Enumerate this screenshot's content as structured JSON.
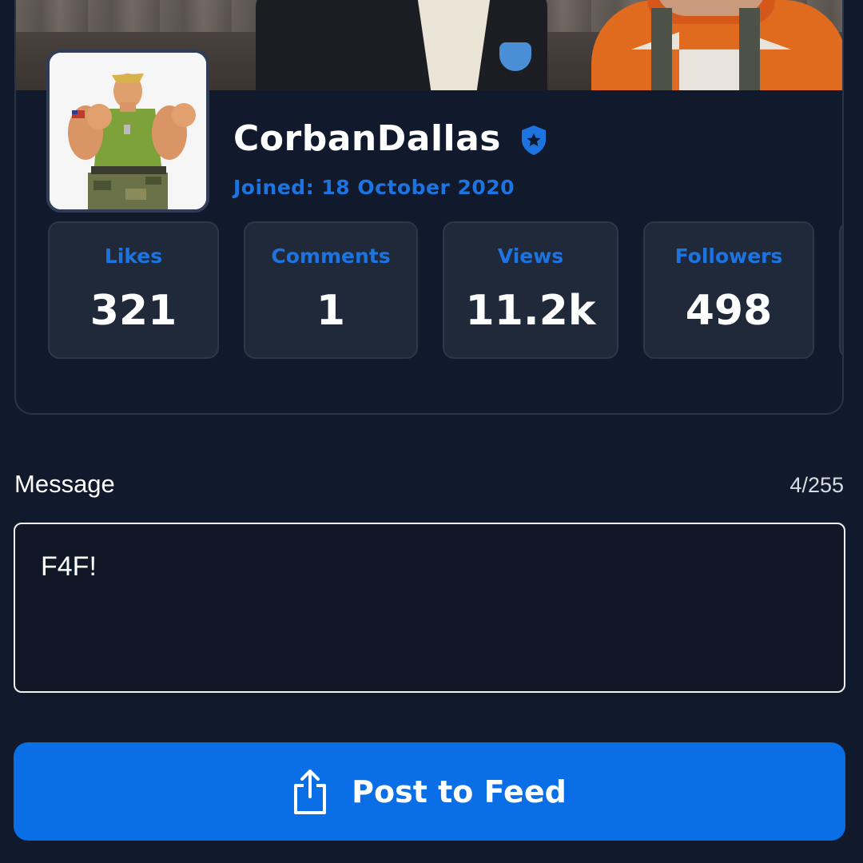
{
  "profile": {
    "username": "CorbanDallas",
    "joined": "Joined: 18 October 2020",
    "verified_icon": "verified-shield-icon"
  },
  "stats": [
    {
      "label": "Likes",
      "value": "321"
    },
    {
      "label": "Comments",
      "value": "1"
    },
    {
      "label": "Views",
      "value": "11.2k"
    },
    {
      "label": "Followers",
      "value": "498"
    }
  ],
  "message": {
    "label": "Message",
    "char_count": "4/255",
    "value": "F4F!"
  },
  "actions": {
    "post_label": "Post to Feed",
    "post_icon": "share-icon"
  },
  "colors": {
    "background": "#111a2c",
    "accent": "#1d74e0",
    "button": "#0a6ee6",
    "card": "#1f2939"
  }
}
